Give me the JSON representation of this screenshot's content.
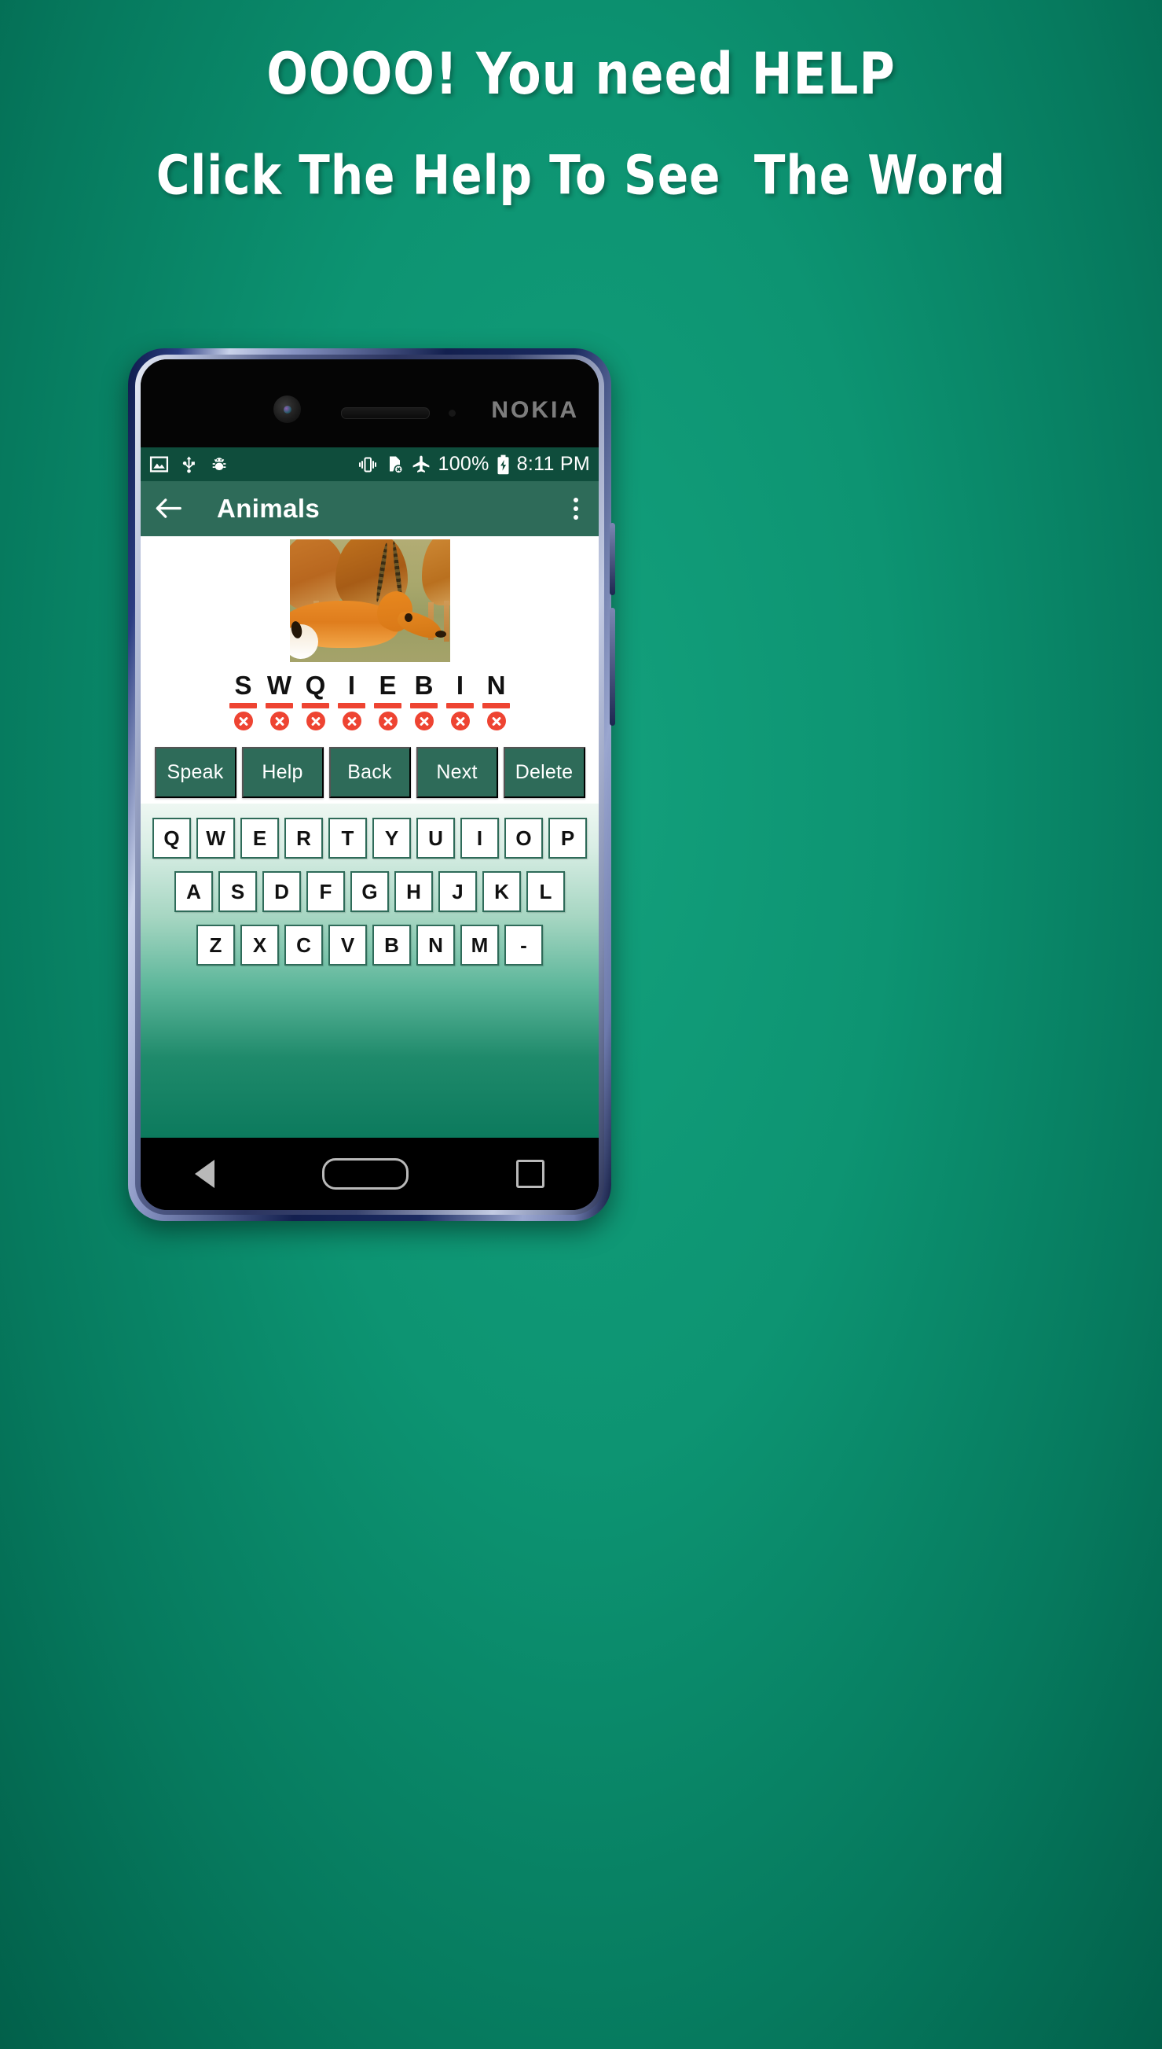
{
  "promo": {
    "line1": "OOOO! You need HELP",
    "line2": "Click The Help To See  The Word",
    "background_color": "#0a8a68",
    "text_color": "#ffffff"
  },
  "device": {
    "brand": "NOKIA",
    "body_color": "#1d2750"
  },
  "status_bar": {
    "background_color": "#0f4d3c",
    "left_icons": [
      "image-icon",
      "usb-icon",
      "android-bug-icon"
    ],
    "right_icons": [
      "vibrate-icon",
      "no-sim-icon",
      "airplane-mode-icon"
    ],
    "battery_percent": "100%",
    "battery_icon": "battery-charging-icon",
    "time": "8:11 PM"
  },
  "app_bar": {
    "back_icon": "arrow-left-icon",
    "title": "Animals",
    "overflow_icon": "more-vertical-icon",
    "background_color": "#2e6b59"
  },
  "main": {
    "image_alt": "impala-antelope-photo",
    "word_letters": [
      "S",
      "W",
      "Q",
      "I",
      "E",
      "B",
      "I",
      "N"
    ],
    "letter_marks": [
      "x",
      "x",
      "x",
      "x",
      "x",
      "x",
      "x",
      "x"
    ],
    "mark_color": "#ee4432",
    "action_buttons": [
      {
        "label": "Speak",
        "name": "speak-button"
      },
      {
        "label": "Help",
        "name": "help-button"
      },
      {
        "label": "Back",
        "name": "back-button"
      },
      {
        "label": "Next",
        "name": "next-button"
      },
      {
        "label": "Delete",
        "name": "delete-button"
      }
    ]
  },
  "keyboard": {
    "row1": [
      "Q",
      "W",
      "E",
      "R",
      "T",
      "Y",
      "U",
      "I",
      "O",
      "P"
    ],
    "row2": [
      "A",
      "S",
      "D",
      "F",
      "G",
      "H",
      "J",
      "K",
      "L"
    ],
    "row3": [
      "Z",
      "X",
      "C",
      "V",
      "B",
      "N",
      "M",
      "-"
    ],
    "key_border_color": "#2e6b59"
  },
  "nav_bar": {
    "back": "nav-back-icon",
    "home": "nav-home-icon",
    "recents": "nav-recents-icon"
  }
}
